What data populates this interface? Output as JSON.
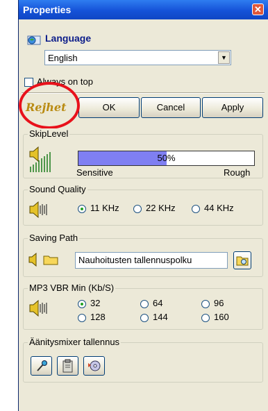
{
  "window": {
    "title": "Properties",
    "close_glyph": "✕"
  },
  "language": {
    "label": "Language",
    "selected": "English",
    "arrow_glyph": "▼"
  },
  "always_on_top": {
    "label": "Always on top",
    "checked": false
  },
  "logo": {
    "text": "Rejhet"
  },
  "buttons": {
    "ok": "OK",
    "cancel": "Cancel",
    "apply": "Apply"
  },
  "skip_level": {
    "legend": "SkipLevel",
    "percent_text": "50%",
    "level": 0.5,
    "min_label": "Sensitive",
    "max_label": "Rough"
  },
  "sound_quality": {
    "legend": "Sound Quality",
    "options": [
      "11 KHz",
      "22 KHz",
      "44 KHz"
    ],
    "selected": "11 KHz"
  },
  "saving_path": {
    "legend": "Saving Path",
    "value": "Nauhoitusten tallennuspolku"
  },
  "mp3_vbr": {
    "legend": "MP3 VBR Min (Kb/S)",
    "options": [
      "32",
      "64",
      "96",
      "128",
      "144",
      "160"
    ],
    "selected": "32"
  },
  "mixer": {
    "legend": "Äänitysmixer tallennus"
  },
  "icons": [
    "globe-icon",
    "speaker-icon",
    "folder-icon",
    "microphone-icon",
    "clipboard-icon",
    "media-icon",
    "browse-icon"
  ],
  "colors": {
    "titlebar": "#1552d8",
    "progress": "#7f7ff2",
    "highlight": "#e8111b",
    "close": "#e0583a"
  }
}
